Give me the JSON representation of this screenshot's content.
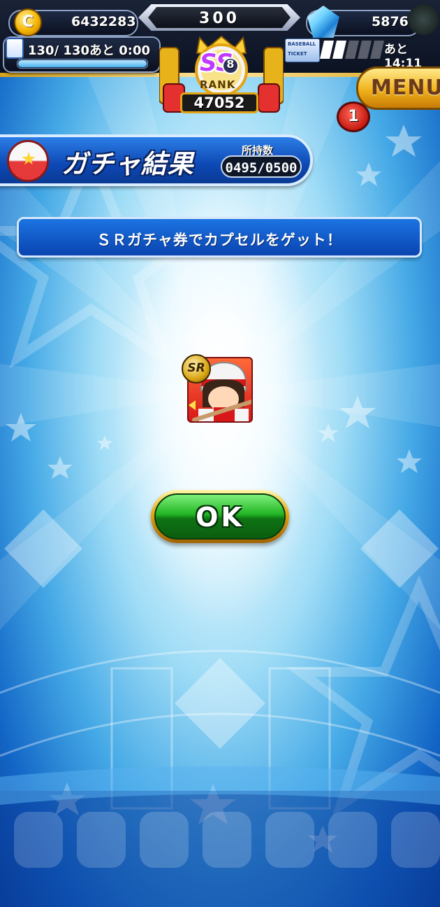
{
  "currency": {
    "coins": "6432283",
    "center_counter": "300",
    "gems": "5876"
  },
  "stamina": {
    "text": "130/ 130あと  0:00",
    "fill_fraction": 1.0
  },
  "rank": {
    "grade": "SS",
    "grade_level": "8",
    "label": "RANK",
    "points": "47052"
  },
  "ticket": {
    "line1": "BASEBALL",
    "line2": "TICKET",
    "timer": "あと14:11"
  },
  "menu": {
    "label": "MENU",
    "badge": "1"
  },
  "header": {
    "title": "ガチャ結果",
    "owned_label": "所持数",
    "owned_value": "0495/0500"
  },
  "message": "ＳＲガチャ券でカプセルをゲット！",
  "result_card": {
    "rarity": "SR"
  },
  "ok_button": {
    "label": "OK"
  },
  "colors": {
    "accent_blue": "#0d48b4",
    "ok_green": "#22b524",
    "gold": "#e2a414",
    "card_red": "#d81818"
  }
}
